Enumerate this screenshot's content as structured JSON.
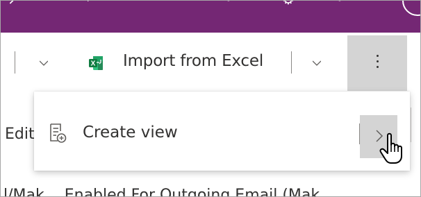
{
  "command_bar": {
    "import_label": "Import from Excel",
    "excel_icon_letter": "X",
    "more_icon": "more-vertical-icon"
  },
  "overflow_menu": {
    "items": [
      {
        "label": "Create view",
        "icon": "create-view-icon",
        "submenu_icon": "chevron-right-icon"
      }
    ]
  },
  "background": {
    "edit_partial_label": "Edit",
    "column_headers_partial": "l/Mak… Enabled For Outgoing Email (Mak"
  },
  "colors": {
    "topbar": "#742774",
    "excel_green": "#107c41",
    "hover_gray": "#d4d4d4",
    "text": "#323130"
  }
}
